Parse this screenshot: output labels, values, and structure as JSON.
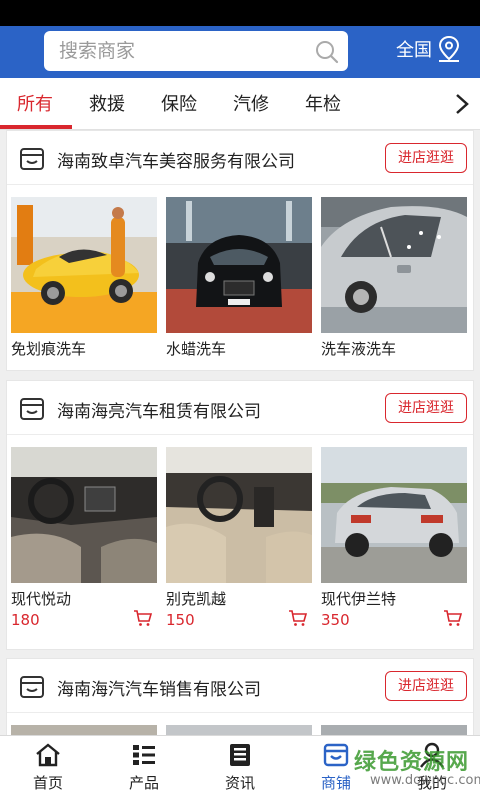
{
  "search": {
    "placeholder": "搜索商家"
  },
  "header": {
    "region_label": "全国"
  },
  "tabs": [
    {
      "label": "所有",
      "active": true
    },
    {
      "label": "救援"
    },
    {
      "label": "保险"
    },
    {
      "label": "汽修"
    },
    {
      "label": "年检"
    }
  ],
  "stores": [
    {
      "name": "海南致卓汽车美容服务有限公司",
      "visit_label": "进店逛逛",
      "products": [
        {
          "name": "免划痕洗车",
          "photo": "yellow-sports-car"
        },
        {
          "name": "水蜡洗车",
          "photo": "black-sedan"
        },
        {
          "name": "洗车液洗车",
          "photo": "silver-wet-car"
        }
      ]
    },
    {
      "name": "海南海亮汽车租赁有限公司",
      "visit_label": "进店逛逛",
      "products": [
        {
          "name": "现代悦动",
          "price": "180",
          "photo": "dark-car-interior"
        },
        {
          "name": "别克凯越",
          "price": "150",
          "photo": "beige-car-interior"
        },
        {
          "name": "现代伊兰特",
          "price": "350",
          "photo": "silver-sedan-rear"
        }
      ]
    },
    {
      "name": "海南海汽汽车销售有限公司",
      "visit_label": "进店逛逛",
      "products": []
    }
  ],
  "bottom_nav": [
    {
      "label": "首页",
      "icon": "home-icon"
    },
    {
      "label": "产品",
      "icon": "list-icon"
    },
    {
      "label": "资讯",
      "icon": "news-icon"
    },
    {
      "label": "商铺",
      "icon": "shop-icon",
      "active": true
    },
    {
      "label": "我的",
      "icon": "user-icon"
    }
  ],
  "watermark": {
    "title": "绿色资源网",
    "url": "www.downcc.com"
  },
  "colors": {
    "brand_blue": "#2b63c6",
    "accent_red": "#d9272e"
  }
}
